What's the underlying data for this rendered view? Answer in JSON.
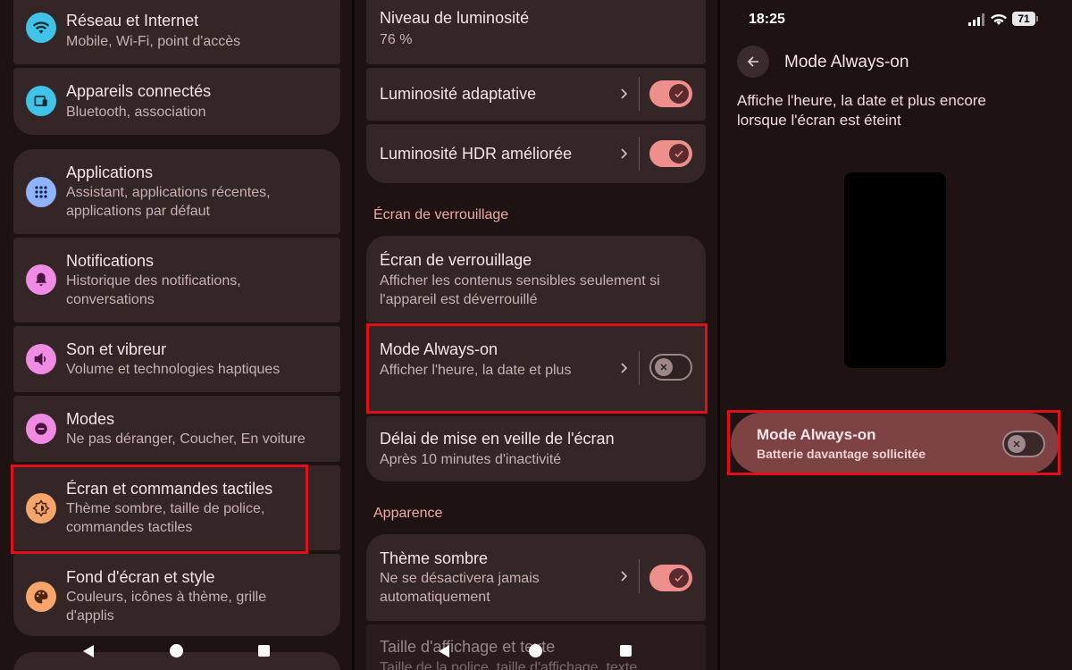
{
  "colors": {
    "background": "#1e1213",
    "card": "#342526",
    "accent_toggle": "#ec8f8d",
    "section_header": "#f0aaa4",
    "highlight": "#e0101a",
    "aod_card": "#7d4244"
  },
  "left_panel": {
    "items": [
      {
        "title": "Réseau et Internet",
        "subtitle": "Mobile, Wi-Fi, point d'accès",
        "icon": "wifi-icon",
        "icon_color": "#3fc3e8"
      },
      {
        "title": "Appareils connectés",
        "subtitle": "Bluetooth, association",
        "icon": "connected-devices-icon",
        "icon_color": "#3fc3e8"
      },
      {
        "title": "Applications",
        "subtitle": "Assistant, applications récentes, applications par défaut",
        "icon": "apps-grid-icon",
        "icon_color": "#8fb3ff"
      },
      {
        "title": "Notifications",
        "subtitle": "Historique des notifications, conversations",
        "icon": "bell-icon",
        "icon_color": "#f08be3"
      },
      {
        "title": "Son et vibreur",
        "subtitle": "Volume et technologies haptiques",
        "icon": "speaker-icon",
        "icon_color": "#f08be3"
      },
      {
        "title": "Modes",
        "subtitle": "Ne pas déranger, Coucher, En voiture",
        "icon": "minus-circle-icon",
        "icon_color": "#f08be3"
      },
      {
        "title": "Écran et commandes tactiles",
        "subtitle": "Thème sombre, taille de police, commandes tactiles",
        "icon": "brightness-icon",
        "icon_color": "#f7a56a"
      },
      {
        "title": "Fond d'écran et style",
        "subtitle": "Couleurs, icônes à thème, grille d'applis",
        "icon": "palette-icon",
        "icon_color": "#f7a56a"
      }
    ]
  },
  "middle_panel": {
    "brightness_level": {
      "title": "Niveau de luminosité",
      "value": "76 %"
    },
    "adaptive_brightness": {
      "title": "Luminosité adaptative",
      "enabled": true
    },
    "hdr_brightness": {
      "title": "Luminosité HDR améliorée",
      "enabled": true
    },
    "lock_section": "Écran de verrouillage",
    "lock_screen": {
      "title": "Écran de verrouillage",
      "subtitle": "Afficher les contenus sensibles seulement si l'appareil est déverrouillé"
    },
    "always_on": {
      "title": "Mode Always-on",
      "subtitle": "Afficher l'heure, la date et plus",
      "enabled": false
    },
    "sleep_delay": {
      "title": "Délai de mise en veille de l'écran",
      "subtitle": "Après 10 minutes d'inactivité"
    },
    "appearance_section": "Apparence",
    "dark_theme": {
      "title": "Thème sombre",
      "subtitle": "Ne se désactivera jamais automatiquement",
      "enabled": true
    },
    "display_size": {
      "title": "Taille d'affichage et texte",
      "subtitle": "Taille de la police, taille d'affichage, texte"
    }
  },
  "right_panel": {
    "status_time": "18:25",
    "battery_level": "71",
    "page_title": "Mode Always-on",
    "description": "Affiche l'heure, la date et plus encore lorsque l'écran est éteint",
    "setting": {
      "title": "Mode Always-on",
      "subtitle": "Batterie davantage sollicitée",
      "enabled": false
    }
  }
}
